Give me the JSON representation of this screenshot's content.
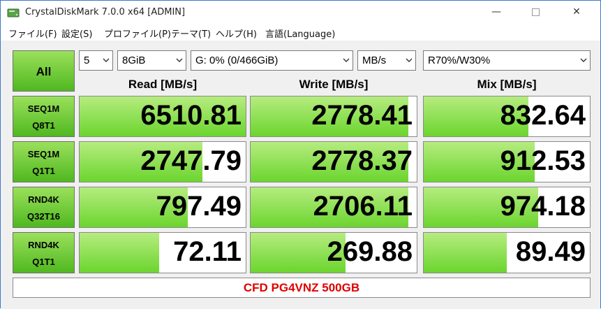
{
  "window": {
    "title": "CrystalDiskMark 7.0.0 x64 [ADMIN]",
    "controls": {
      "minimize": "—",
      "maximize": "☐",
      "close": "✕"
    }
  },
  "menu": [
    "ファイル(F)",
    "設定(S)",
    "プロファイル(P)",
    "テーマ(T)",
    "ヘルプ(H)",
    "言語(Language)"
  ],
  "controls": {
    "all_label": "All",
    "count": "5",
    "size": "8GiB",
    "drive": "G: 0% (0/466GiB)",
    "unit": "MB/s",
    "mix": "R70%/W30%"
  },
  "headers": {
    "read": "Read [MB/s]",
    "write": "Write [MB/s]",
    "mix": "Mix [MB/s]"
  },
  "rows": [
    {
      "line1": "SEQ1M",
      "line2": "Q8T1",
      "read": "6510.81",
      "write": "2778.41",
      "mix": "832.64",
      "read_fill": 1.0,
      "write_fill": 0.95,
      "mix_fill": 0.63
    },
    {
      "line1": "SEQ1M",
      "line2": "Q1T1",
      "read": "2747.79",
      "write": "2778.37",
      "mix": "912.53",
      "read_fill": 0.74,
      "write_fill": 0.95,
      "mix_fill": 0.67
    },
    {
      "line1": "RND4K",
      "line2": "Q32T16",
      "read": "797.49",
      "write": "2706.11",
      "mix": "974.18",
      "read_fill": 0.65,
      "write_fill": 0.95,
      "mix_fill": 0.69
    },
    {
      "line1": "RND4K",
      "line2": "Q1T1",
      "read": "72.11",
      "write": "269.88",
      "mix": "89.49",
      "read_fill": 0.48,
      "write_fill": 0.57,
      "mix_fill": 0.5
    }
  ],
  "comment": "CFD PG4VNZ 500GB",
  "colors": {
    "accent_green": "#4fb81f",
    "comment_red": "#e00000"
  }
}
